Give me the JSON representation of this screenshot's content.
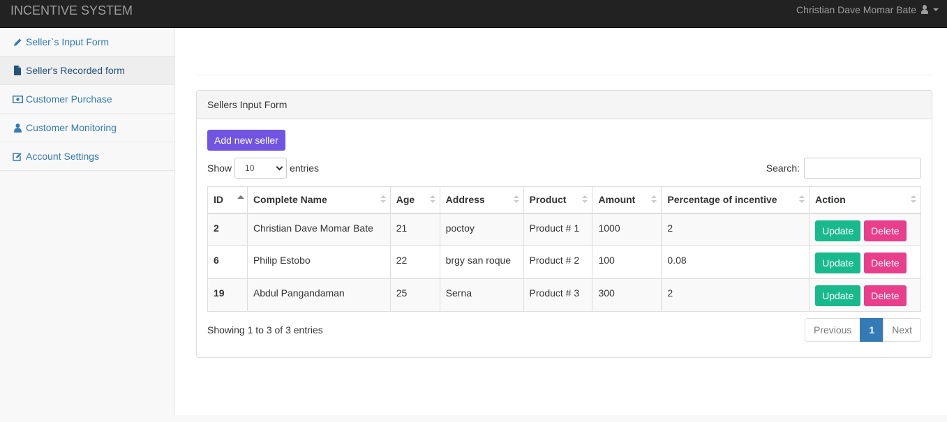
{
  "navbar": {
    "brand": "INCENTIVE SYSTEM",
    "user_name": "Christian Dave Momar Bate",
    "user_icon": "user-icon"
  },
  "sidebar": {
    "items": [
      {
        "label": "Seller`s Input Form",
        "icon": "pencil-icon"
      },
      {
        "label": "Seller's Recorded form",
        "icon": "file-icon",
        "active": true
      },
      {
        "label": "Customer Purchase",
        "icon": "money-icon"
      },
      {
        "label": "Customer Monitoring",
        "icon": "user-icon"
      },
      {
        "label": "Account Settings",
        "icon": "edit-icon"
      }
    ]
  },
  "panel": {
    "heading": "Sellers Input Form",
    "add_button": "Add new seller",
    "show_label": "Show",
    "entries_label": "entries",
    "page_length": "10",
    "search_label": "Search:",
    "search_value": ""
  },
  "table": {
    "columns": [
      "ID",
      "Complete Name",
      "Age",
      "Address",
      "Product",
      "Amount",
      "Percentage of incentive",
      "Action"
    ],
    "rows": [
      {
        "id": "2",
        "name": "Christian Dave Momar Bate",
        "age": "21",
        "address": "poctoy",
        "product": "Product # 1",
        "amount": "1000",
        "percentage": "2"
      },
      {
        "id": "6",
        "name": "Philip Estobo",
        "age": "22",
        "address": "brgy san roque",
        "product": "Product # 2",
        "amount": "100",
        "percentage": "0.08"
      },
      {
        "id": "19",
        "name": "Abdul Pangandaman",
        "age": "25",
        "address": "Serna",
        "product": "Product # 3",
        "amount": "300",
        "percentage": "2"
      }
    ],
    "update_label": "Update",
    "delete_label": "Delete"
  },
  "footer": {
    "info": "Showing 1 to 3 of 3 entries",
    "previous": "Previous",
    "current_page": "1",
    "next": "Next"
  },
  "colors": {
    "navbar": "#222222",
    "add_button": "#7254e3",
    "update_button": "#18b98a",
    "delete_button": "#e83e8c",
    "pagination_active": "#337ab7"
  }
}
